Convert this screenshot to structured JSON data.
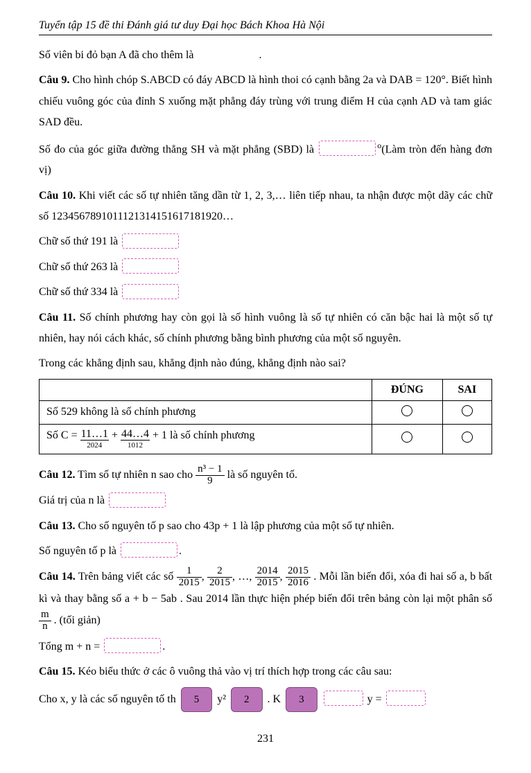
{
  "header": "Tuyển tập 15 đề thi Đánh giá tư duy Đại học Bách Khoa Hà Nội",
  "intro_line": "Số viên bi đỏ bạn A đã cho thêm là",
  "q9": {
    "label": "Câu 9.",
    "s1a": " Cho hình chóp S.ABCD có đáy ABCD là hình thoi có cạnh bằng 2a và ",
    "s1b": "DAB = 120°",
    "s1c": ". Biết hình chiếu vuông góc của đỉnh S xuống mặt phẳng đáy trùng với trung điểm H của cạnh AD và tam giác SAD đều.",
    "s2a": "Số đo của góc giữa đường thẳng SH và mặt phẳng (SBD) là ",
    "s2b": "(Làm tròn đến hàng đơn vị)",
    "deg": "o"
  },
  "q10": {
    "label": "Câu 10.",
    "s1": " Khi viết các số tự nhiên tăng dần từ 1, 2, 3,… liên tiếp nhau, ta nhận được một dãy các chữ số 1234567891011121314151617181920…",
    "r1": "Chữ số thứ 191 là",
    "r2": "Chữ số thứ 263 là",
    "r3": "Chữ số thứ 334 là"
  },
  "q11": {
    "label": "Câu 11.",
    "s1": " Số chính phương hay còn gọi là số hình vuông là số tự nhiên có căn bậc hai là một số tự nhiên, hay nói cách khác, số chính phương bằng bình phương của một số nguyên.",
    "s2": "Trong các khẳng định sau, khẳng định nào đúng, khẳng định nào sai?",
    "th1": "ĐÚNG",
    "th2": "SAI",
    "row1": "Số 529 không là số chính phương",
    "row2_pre": "Số  C = ",
    "row2_a_top": "11…1",
    "row2_a_bot": "2024",
    "row2_plus": " + ",
    "row2_b_top": "44…4",
    "row2_b_bot": "1012",
    "row2_suf": " + 1   là số chính phương"
  },
  "q12": {
    "label": "Câu 12.",
    "s1a": " Tìm số tự nhiên n sao cho  ",
    "frac_num": "n³ − 1",
    "frac_den": "9",
    "s1b": "  là số nguyên tố.",
    "s2": "Giá trị của n là"
  },
  "q13": {
    "label": "Câu 13.",
    "s1": " Cho số nguyên tố p sao cho 43p + 1 là lập phương của một số tự nhiên.",
    "s2": "Số nguyên tố p là"
  },
  "q14": {
    "label": "Câu 14.",
    "s1a": " Trên bảng viết các số  ",
    "f1n": "1",
    "f1d": "2015",
    "f2n": "2",
    "f2d": "2015",
    "dots": ", …, ",
    "f3n": "2014",
    "f3d": "2015",
    "f4n": "2015",
    "f4d": "2016",
    "s1b": " . Mỗi lần biến đổi, xóa đi hai số  a, b  bất kì và thay bằng số  a + b − 5ab . Sau 2014 lần thực hiện phép biến đổi trên bảng còn lại một phân số  ",
    "fmn_n": "m",
    "fmn_d": "n",
    "s1c": " . (tối giản)",
    "s2": "Tổng m + n ="
  },
  "q15": {
    "label": "Câu 15.",
    "s1": " Kéo biểu thức ở các ô vuông thả vào vị trí thích hợp trong các câu sau:",
    "s2a": "Cho x, y là các số nguyên tố th",
    "s2b": "y²",
    "s2c": ". K",
    "s2d": "y = ",
    "tok1": "5",
    "tok2": "2",
    "tok3": "3"
  },
  "page_num": "231"
}
